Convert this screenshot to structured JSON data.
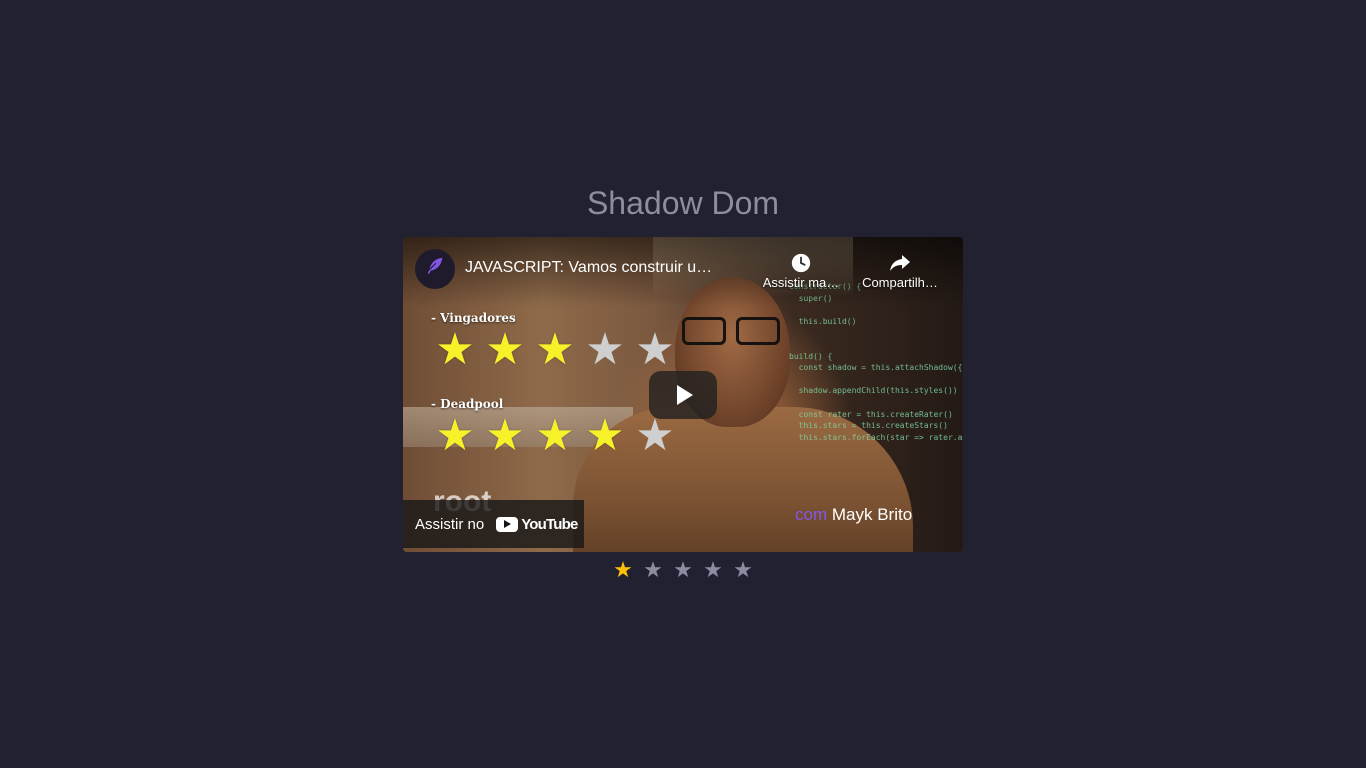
{
  "page": {
    "heading": "Shadow Dom",
    "background": "#222131",
    "heading_color": "#8d8ca1"
  },
  "video": {
    "title": "JAVASCRIPT: Vamos construir u…",
    "channel_icon": "feather-icon",
    "actions": [
      {
        "label": "Assistir ma…",
        "icon": "clock-icon"
      },
      {
        "label": "Compartilh…",
        "icon": "share-icon"
      }
    ],
    "play_icon": "play-icon",
    "watch_on_label": "Assistir no",
    "youtube_word": "YouTube",
    "thumbnail": {
      "groups": [
        {
          "label": "- Vingadores",
          "rating": 3,
          "max": 5
        },
        {
          "label": "- Deadpool",
          "rating": 4,
          "max": 5
        }
      ],
      "watermark": "root",
      "credit_prefix": "com",
      "credit_name": "Mayk Brito",
      "code_lines": [
        "constructor() {",
        "  super()",
        "",
        "  this.build()",
        "",
        "",
        "build() {",
        "  const shadow = this.attachShadow({ m",
        "",
        "  shadow.appendChild(this.styles())",
        "",
        "  const rater = this.createRater()",
        "  this.stars = this.createStars()",
        "  this.stars.forEach(star => rater.ap"
      ],
      "star_on_color": "#f6f129",
      "star_off_color": "#cfcfcf"
    }
  },
  "rater": {
    "rating": 1,
    "max": 5,
    "active_color": "#ffc107",
    "inactive_color": "#8d8ca1",
    "star_glyph": "★"
  }
}
